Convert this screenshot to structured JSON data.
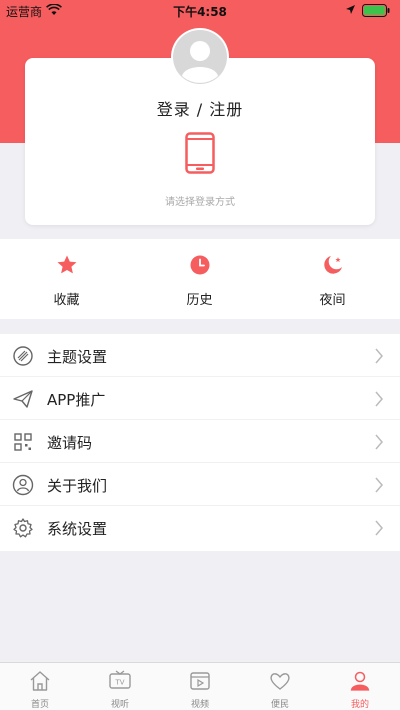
{
  "status_bar": {
    "carrier": "运营商",
    "time": "下午4:58"
  },
  "login": {
    "title": "登录 / 注册",
    "hint": "请选择登录方式"
  },
  "quick_actions": [
    {
      "label": "收藏",
      "icon": "star-icon"
    },
    {
      "label": "历史",
      "icon": "clock-icon"
    },
    {
      "label": "夜间",
      "icon": "moon-icon"
    }
  ],
  "menu": [
    {
      "label": "主题设置",
      "icon": "theme-icon"
    },
    {
      "label": "APP推广",
      "icon": "paper-plane-icon"
    },
    {
      "label": "邀请码",
      "icon": "qr-code-icon"
    },
    {
      "label": "关于我们",
      "icon": "user-circle-icon"
    },
    {
      "label": "系统设置",
      "icon": "gear-icon"
    }
  ],
  "tabs": [
    {
      "label": "首页",
      "icon": "home-icon"
    },
    {
      "label": "视听",
      "icon": "tv-icon"
    },
    {
      "label": "视频",
      "icon": "video-icon"
    },
    {
      "label": "便民",
      "icon": "heart-icon"
    },
    {
      "label": "我的",
      "icon": "person-icon",
      "active": true
    }
  ],
  "colors": {
    "accent": "#f65d5f",
    "background": "#efeff4"
  }
}
